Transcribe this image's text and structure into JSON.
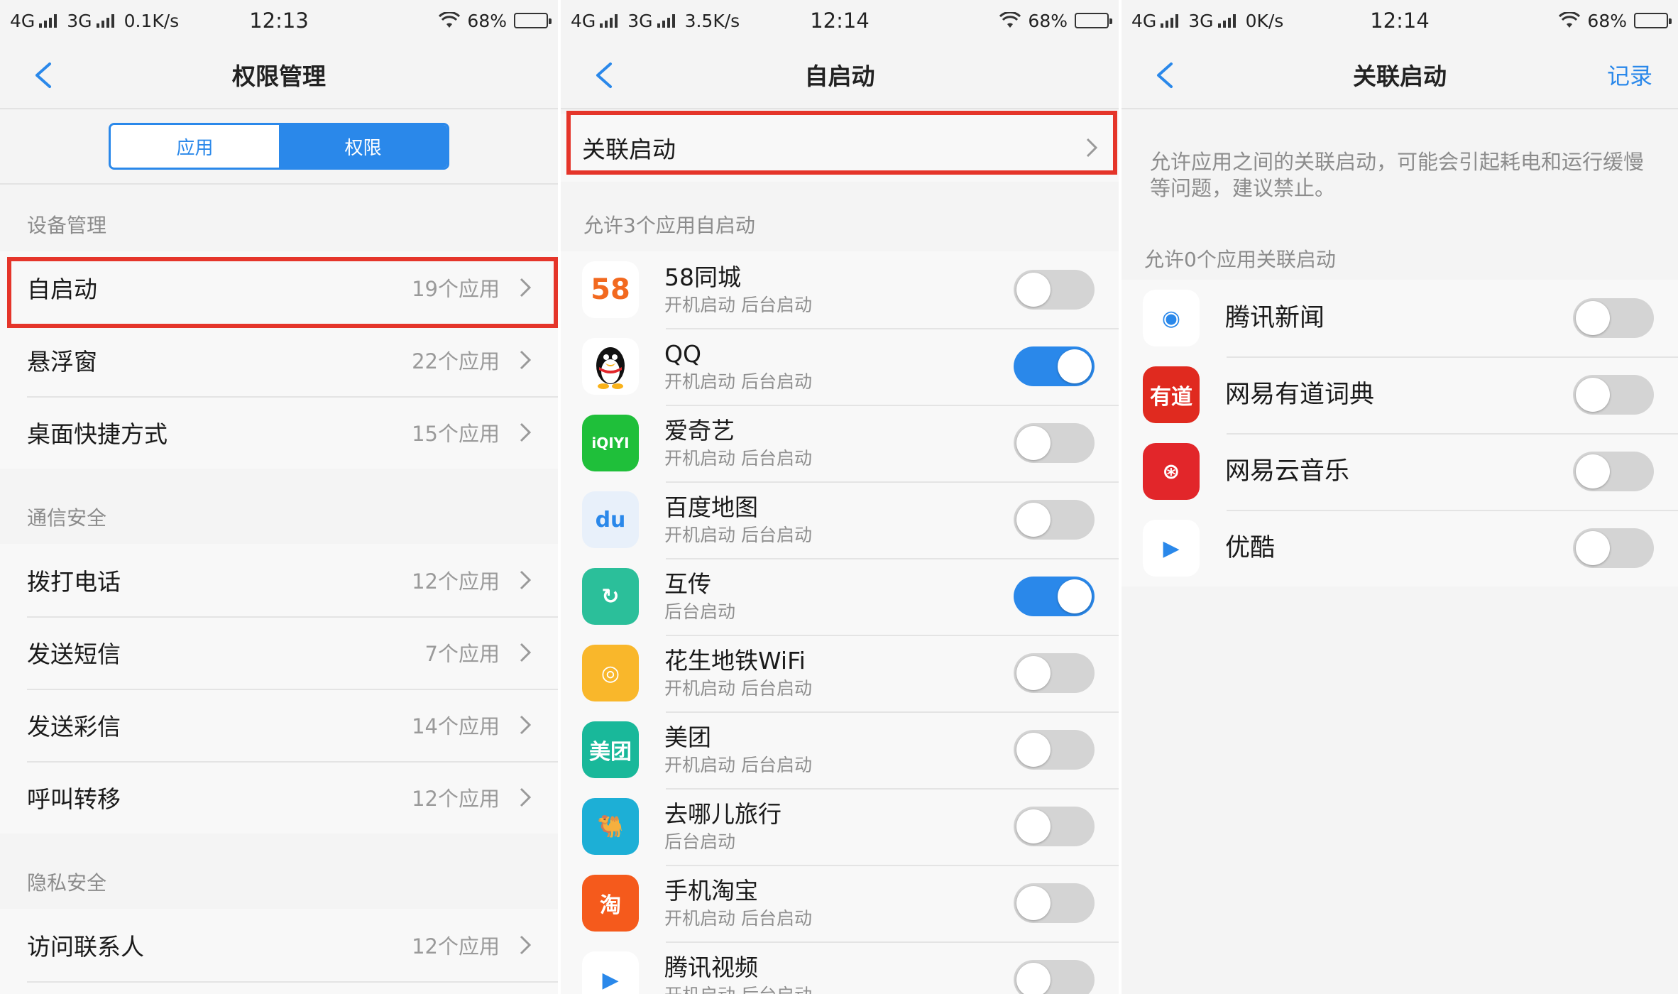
{
  "screen1": {
    "status": {
      "net1": "4G",
      "net2": "3G",
      "speed": "0.1K/s",
      "time": "12:13",
      "battery": "68%",
      "battery_level": 0.68
    },
    "title": "权限管理",
    "tabs": [
      "应用",
      "权限"
    ],
    "active_tab": "权限",
    "sections": [
      {
        "title": "设备管理",
        "items": [
          {
            "label": "自启动",
            "count": "19个应用"
          },
          {
            "label": "悬浮窗",
            "count": "22个应用"
          },
          {
            "label": "桌面快捷方式",
            "count": "15个应用"
          }
        ]
      },
      {
        "title": "通信安全",
        "items": [
          {
            "label": "拨打电话",
            "count": "12个应用"
          },
          {
            "label": "发送短信",
            "count": "7个应用"
          },
          {
            "label": "发送彩信",
            "count": "14个应用"
          },
          {
            "label": "呼叫转移",
            "count": "12个应用"
          }
        ]
      },
      {
        "title": "隐私安全",
        "items": [
          {
            "label": "访问联系人",
            "count": "12个应用"
          }
        ]
      }
    ]
  },
  "screen2": {
    "status": {
      "net1": "4G",
      "net2": "3G",
      "speed": "3.5K/s",
      "time": "12:14",
      "battery": "68%",
      "battery_level": 0.68
    },
    "title": "自启动",
    "top_entry": "关联启动",
    "section_title": "允许3个应用自启动",
    "apps": [
      {
        "name": "58同城",
        "sub": "开机启动   后台启动",
        "on": false,
        "icon": "58-tongcheng-icon",
        "color": "#ffffff",
        "glyph": "58"
      },
      {
        "name": "QQ",
        "sub": "开机启动   后台启动",
        "on": true,
        "icon": "qq-penguin-icon",
        "color": "#ffffff",
        "glyph": ""
      },
      {
        "name": "爱奇艺",
        "sub": "开机启动   后台启动",
        "on": false,
        "icon": "iqiyi-icon",
        "color": "#1fbf3a",
        "glyph": "iQIYI"
      },
      {
        "name": "百度地图",
        "sub": "开机启动   后台启动",
        "on": false,
        "icon": "baidu-map-icon",
        "color": "#e8f0fa",
        "glyph": "du"
      },
      {
        "name": "互传",
        "sub": "后台启动",
        "on": true,
        "icon": "hu-chuan-icon",
        "color": "#2bbf9a",
        "glyph": "↻"
      },
      {
        "name": "花生地铁WiFi",
        "sub": "开机启动   后台启动",
        "on": false,
        "icon": "peanut-wifi-icon",
        "color": "#f9b72b",
        "glyph": "◎"
      },
      {
        "name": "美团",
        "sub": "开机启动   后台启动",
        "on": false,
        "icon": "meituan-icon",
        "color": "#19b89a",
        "glyph": "美团"
      },
      {
        "name": "去哪儿旅行",
        "sub": "后台启动",
        "on": false,
        "icon": "qunar-camel-icon",
        "color": "#1dafd6",
        "glyph": "🐫"
      },
      {
        "name": "手机淘宝",
        "sub": "开机启动   后台启动",
        "on": false,
        "icon": "taobao-icon",
        "color": "#f55a1c",
        "glyph": "淘"
      },
      {
        "name": "腾讯视频",
        "sub": "开机启动   后台启动",
        "on": false,
        "icon": "tencent-video-icon",
        "color": "#ffffff",
        "glyph": "▶"
      }
    ]
  },
  "screen3": {
    "status": {
      "net1": "4G",
      "net2": "3G",
      "speed": "0K/s",
      "time": "12:14",
      "battery": "68%",
      "battery_level": 0.68
    },
    "title": "关联启动",
    "right_link": "记录",
    "description": "允许应用之间的关联启动，可能会引起耗电和运行缓慢等问题，建议禁止。",
    "section_title": "允许0个应用关联启动",
    "apps": [
      {
        "name": "腾讯新闻",
        "on": false,
        "icon": "tencent-news-icon",
        "color": "#ffffff",
        "glyph": "◉"
      },
      {
        "name": "网易有道词典",
        "on": false,
        "icon": "youdao-dict-icon",
        "color": "#e02a1f",
        "glyph": "有道"
      },
      {
        "name": "网易云音乐",
        "on": false,
        "icon": "netease-music-icon",
        "color": "#e2262a",
        "glyph": "⊛"
      },
      {
        "name": "优酷",
        "on": false,
        "icon": "youku-icon",
        "color": "#ffffff",
        "glyph": "▶"
      }
    ]
  },
  "colors": {
    "accent": "#2a88ea",
    "highlight": "#e5352a",
    "toggle_off": "#d4d4d4"
  }
}
